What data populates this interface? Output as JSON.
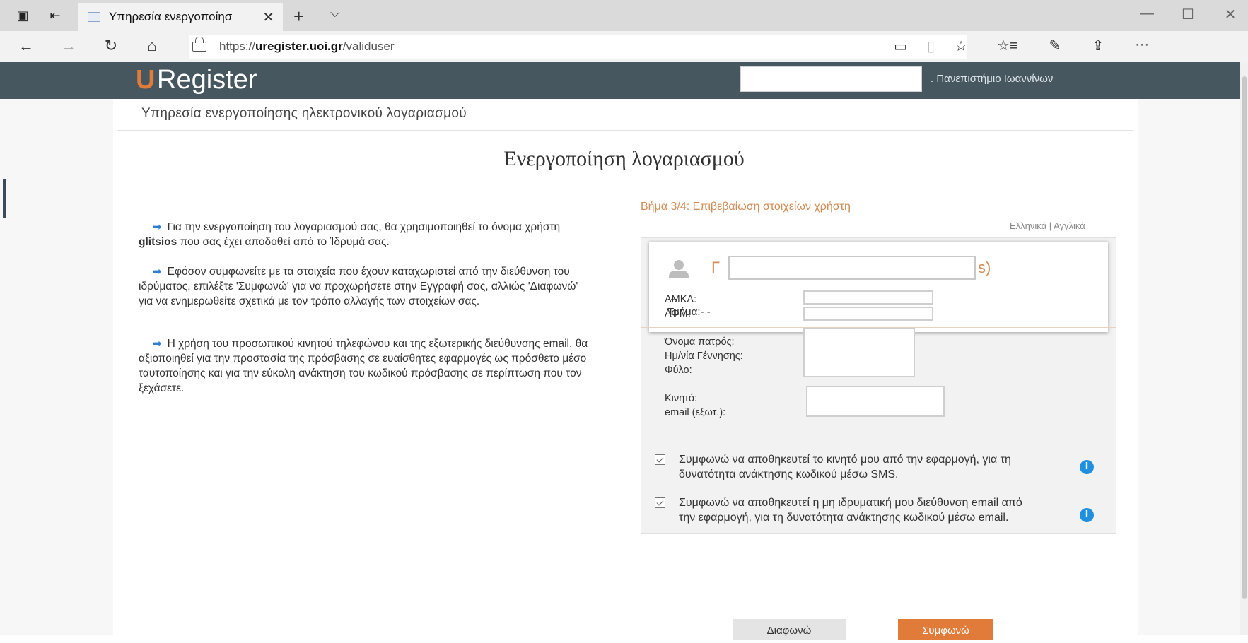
{
  "browser": {
    "tab_title": "Υπηρεσία ενεργοποίησ",
    "tab_close": "✕",
    "new_tab": "+",
    "tab_menu": "⌵",
    "url_prefix": "https://",
    "url_domain": "uregister.uoi.gr",
    "url_path": "/validuser",
    "window_minimize": "—",
    "window_maximize": "☐",
    "window_close": "✕",
    "icons": {
      "back": "←",
      "forward": "→",
      "refresh": "↻",
      "home": "⌂",
      "reading_view": "▭",
      "favorite": "☆",
      "favorites_list": "☆≡",
      "notes": "✎",
      "share": "⇪",
      "more": "···"
    }
  },
  "brand": {
    "u": "U",
    "rest": "Register"
  },
  "header": {
    "university": ". Πανεπιστήμιο Ιωαννίνων"
  },
  "service_title": "Υπηρεσία ενεργοποίησης ηλεκτρονικού λογαριασμού",
  "main_heading": "Ενεργοποίηση λογαριασμού",
  "info": {
    "p1_before": "Για την ενεργοποίηση του λογαριασμού σας, θα χρησιμοποιηθεί το όνομα χρήστη ",
    "p1_username": "glitsios",
    "p1_after": " που σας έχει αποδοθεί από το Ίδρυμά σας.",
    "p2": "Εφόσον συμφωνείτε με τα στοιχεία που έχουν καταχωριστεί από την διεύθυνση του ιδρύματος, επιλέξτε 'Συμφωνώ' για να προχωρήσετε στην Εγγραφή σας, αλλιώς 'Διαφωνώ' για να ενημερωθείτε σχετικά με τον τρόπο αλλαγής των στοιχείων σας.",
    "p3": "Η χρήση του προσωπικού κινητού τηλεφώνου και της εξωτερικής διεύθυνσης email, θα αξιοποιηθεί για την προστασία της πρόσβασης σε ευαίσθητες εφαρμογές ως πρόσθετο μέσο ταυτοποίησης και για την εύκολη ανάκτηση του κωδικού πρόσβασης σε περίπτωση που τον ξεχάσετε.",
    "arrow": "➡"
  },
  "step": "Βήμα 3/4: Επιβεβαίωση στοιχείων χρήστη",
  "languages": "Ελληνικά | Αγγλικά",
  "user": {
    "name_first": "Γ",
    "name_last": "s)",
    "dash": "---",
    "department": "Τμήμα:- -"
  },
  "fields": {
    "amka": "ΑΜΚΑ:",
    "afm": "ΑΦΜ:",
    "father": "Όνομα πατρός:",
    "birth": "Ημ/νία Γέννησης:",
    "gender": "Φύλο:",
    "mobile": "Κινητό:",
    "email": "email (εξωτ.):"
  },
  "consents": [
    {
      "text": "Συμφωνώ να αποθηκευτεί το κινητό μου από την εφαρμογή, για τη δυνατότητα ανάκτησης κωδικού μέσω SMS.",
      "checked": true
    },
    {
      "text": "Συμφωνώ να αποθηκευτεί η μη ιδρυματική μου διεύθυνση email από την εφαρμογή, για τη δυνατότητα ανάκτησης κωδικού μέσω email.",
      "checked": true
    }
  ],
  "info_badge": "i",
  "buttons": {
    "disagree": "Διαφωνώ",
    "agree": "Συμφωνώ"
  },
  "colors": {
    "brand_bar": "#47575f",
    "accent": "#e07b39",
    "step": "#d28c55",
    "info_blue": "#1f8fe0"
  }
}
